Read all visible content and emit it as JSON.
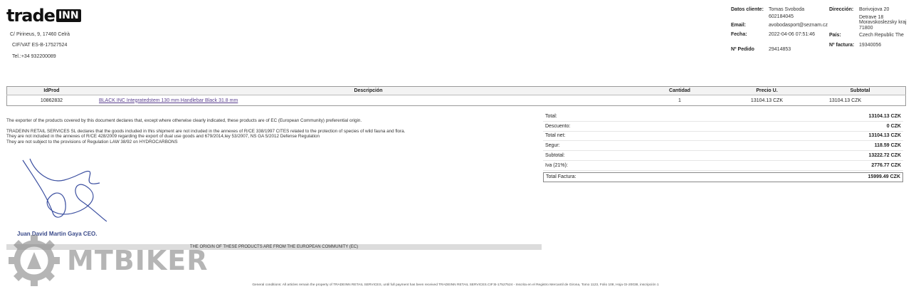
{
  "logo": {
    "word": "trade",
    "badge": "INN"
  },
  "company": {
    "address": "C/ Pirineus, 9, 17460 Celrà",
    "cif": "CIF/VAT ES-B-17527524",
    "tel": "Tel.:+34 932200089"
  },
  "client": {
    "datos_label": "Datos cliente:",
    "name": "Tomas Svoboda",
    "phone": "602184045",
    "email_label": "Email:",
    "email": "avobodasport@seznam.cz",
    "fecha_label": "Fecha:",
    "fecha": "2022-04-06 07:51:46",
    "pedido_label": "Nº Pedido",
    "pedido": "29414853",
    "direccion_label": "Dirección:",
    "addr1": "Borivojova 20",
    "addr2": "Detrave 18",
    "addr3": "Moravskoslezsky kraj",
    "addr4": "71800",
    "pais_label": "País:",
    "pais": "Czech Republic The",
    "factura_label": "Nº factura:",
    "factura": "19340056"
  },
  "table": {
    "headers": {
      "idprod": "IdProd",
      "desc": "Descripción",
      "qty": "Cantidad",
      "price": "Precio U.",
      "subtotal": "Subtotal"
    },
    "rows": [
      {
        "idprod": "10862832",
        "desc": "BLACK INC Integratedstem 130 mm Handlebar Black 31.8 mm",
        "qty": "1",
        "price": "13104.13 CZK",
        "subtotal": "13104.13 CZK"
      }
    ]
  },
  "declaration": {
    "line1": "The exporter of the products covered by this document declares that, except where otherwise clearly indicated, these products are of EC (European Community) preferential origin.",
    "line2": "TRADEINN RETAIL SERVICES SL declares that the goods included in this shipment are not included in the annexes of R/CE 338/1997 CITES related to the protection of species of wild fauna and flora.",
    "line3": "They are not included in the annexes of R/CE 428/2009 regarding the export of dual use goods and 679/2014,ley 53/2007, NS GA 5/2012 Defense Regulation",
    "line4": "They are not subject to the provisions of Regulation LAW 38/92 on HYDROCARBONS"
  },
  "totals": [
    {
      "label": "Total:",
      "value": "13104.13 CZK"
    },
    {
      "label": "Descuento:",
      "value": "0 CZK"
    },
    {
      "label": "Total net:",
      "value": "13104.13 CZK"
    },
    {
      "label": "Segur:",
      "value": "118.59 CZK"
    },
    {
      "label": "Subtotal:",
      "value": "13222.72 CZK"
    },
    {
      "label": "Iva (21%):",
      "value": "2776.77 CZK"
    }
  ],
  "total_factura": {
    "label": "Total Factura:",
    "value": "15999.49 CZK"
  },
  "signature": {
    "name": "Juan David Martin Gaya CEO."
  },
  "origin_note": "THE ORIGIN OF THESE PRODUCTS ARE FROM THE EUROPEAN COMMUNITY (EC)",
  "watermark": "MTBIKER",
  "footer": "General conditions: All articles remain the property of TRADEINN RETAIL SERVICES, until full payment has been received TRADEINN RETAIL SERVICES.CIF:B-17527524 - Inscrita en el Registro Mercantil de Girona, Tomo 1123, Folio 108, Hoja GI-20038, inscripción 1"
}
